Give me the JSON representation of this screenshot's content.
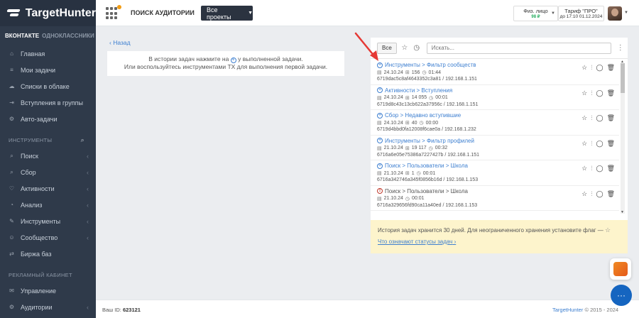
{
  "brand": {
    "name": "TargetHunter"
  },
  "sidebar": {
    "tabs": [
      {
        "label": "ВКОНТАКТЕ"
      },
      {
        "label": "ОДНОКЛАССНИКИ"
      }
    ],
    "main_items": [
      {
        "label": "Главная",
        "icon": "home-icon"
      },
      {
        "label": "Мои задачи",
        "icon": "tasks-icon"
      },
      {
        "label": "Списки в облаке",
        "icon": "cloud-icon"
      },
      {
        "label": "Вступления в группы",
        "icon": "group-join-icon"
      },
      {
        "label": "Авто-задачи",
        "icon": "auto-tasks-icon"
      }
    ],
    "tools_title": "ИНСТРУМЕНТЫ",
    "tools_items": [
      {
        "label": "Поиск",
        "icon": "search-icon"
      },
      {
        "label": "Сбор",
        "icon": "collect-icon"
      },
      {
        "label": "Активности",
        "icon": "heart-icon"
      },
      {
        "label": "Анализ",
        "icon": "analysis-icon"
      },
      {
        "label": "Инструменты",
        "icon": "wrench-icon"
      },
      {
        "label": "Сообщество",
        "icon": "community-icon"
      },
      {
        "label": "Биржа баз",
        "icon": "exchange-icon"
      }
    ],
    "ads_title": "РЕКЛАМНЫЙ КАБИНЕТ",
    "ads_items": [
      {
        "label": "Управление",
        "icon": "manage-icon"
      },
      {
        "label": "Аудитории",
        "icon": "audience-icon"
      }
    ]
  },
  "header": {
    "title": "ПОИСК АУДИТОРИИ",
    "projects_button": "Все проекты",
    "account": {
      "label": "Физ. лицо",
      "balance": "98 ₽"
    },
    "tariff": {
      "name": "Тариф \"ПРО\"",
      "until": "до 17:10 01.12.2024"
    }
  },
  "back_link": "Назад",
  "hint": {
    "line1_a": "В истории задач нажмите на",
    "line1_b": "у выполненной задачи.",
    "line2": "Или воспользуйтесь инструментами TX для выполнения первой задачи."
  },
  "history": {
    "filter_all": "Все",
    "search_placeholder": "Искать...",
    "items": [
      {
        "status": "ok",
        "title": "Инструменты > Фильтр сообществ",
        "date": "24.10.24",
        "count": "156",
        "duration": "01:44",
        "id_ip": "6719dac5c8af4643352c3a81 / 192.168.1.151"
      },
      {
        "status": "ok",
        "title": "Активности > Вступления",
        "date": "24.10.24",
        "count": "14 055",
        "duration": "00:01",
        "id_ip": "6719d8c43c13cb622a37956c / 192.168.1.151"
      },
      {
        "status": "ok",
        "title": "Сбор > Недавно вступившие",
        "date": "24.10.24",
        "count": "40",
        "duration": "00:00",
        "id_ip": "6719d4bbd0fa12008f6cae0a / 192.168.1.232"
      },
      {
        "status": "ok",
        "title": "Инструменты > Фильтр профилей",
        "date": "21.10.24",
        "count": "19 117",
        "duration": "00:32",
        "id_ip": "6716a6e05e75386a7227427b / 192.168.1.151"
      },
      {
        "status": "ok",
        "title": "Поиск > Пользователи > Школа",
        "date": "21.10.24",
        "count": "1",
        "duration": "00:01",
        "id_ip": "6716a342746a345f0856b16d / 192.168.1.153"
      },
      {
        "status": "error",
        "title": "Поиск > Пользователи > Школа",
        "date": "21.10.24",
        "count": "",
        "duration": "00:01",
        "id_ip": "6716a329656fd90ca11a40ed / 192.168.1.153"
      }
    ],
    "notice": "История задач хранится 30 дней. Для неограниченного хранения установите флаг —",
    "notice_link": "Что означают статусы задач"
  },
  "footer": {
    "id_label": "Ваш ID:",
    "id_value": "623121",
    "brand": "TargetHunter",
    "copyright": "© 2015 - 2024"
  },
  "colors": {
    "accent": "#3d7fd0",
    "sidebar": "#2f3a4a",
    "notice_bg": "#fdf4cc",
    "arrow": "#e53935"
  }
}
